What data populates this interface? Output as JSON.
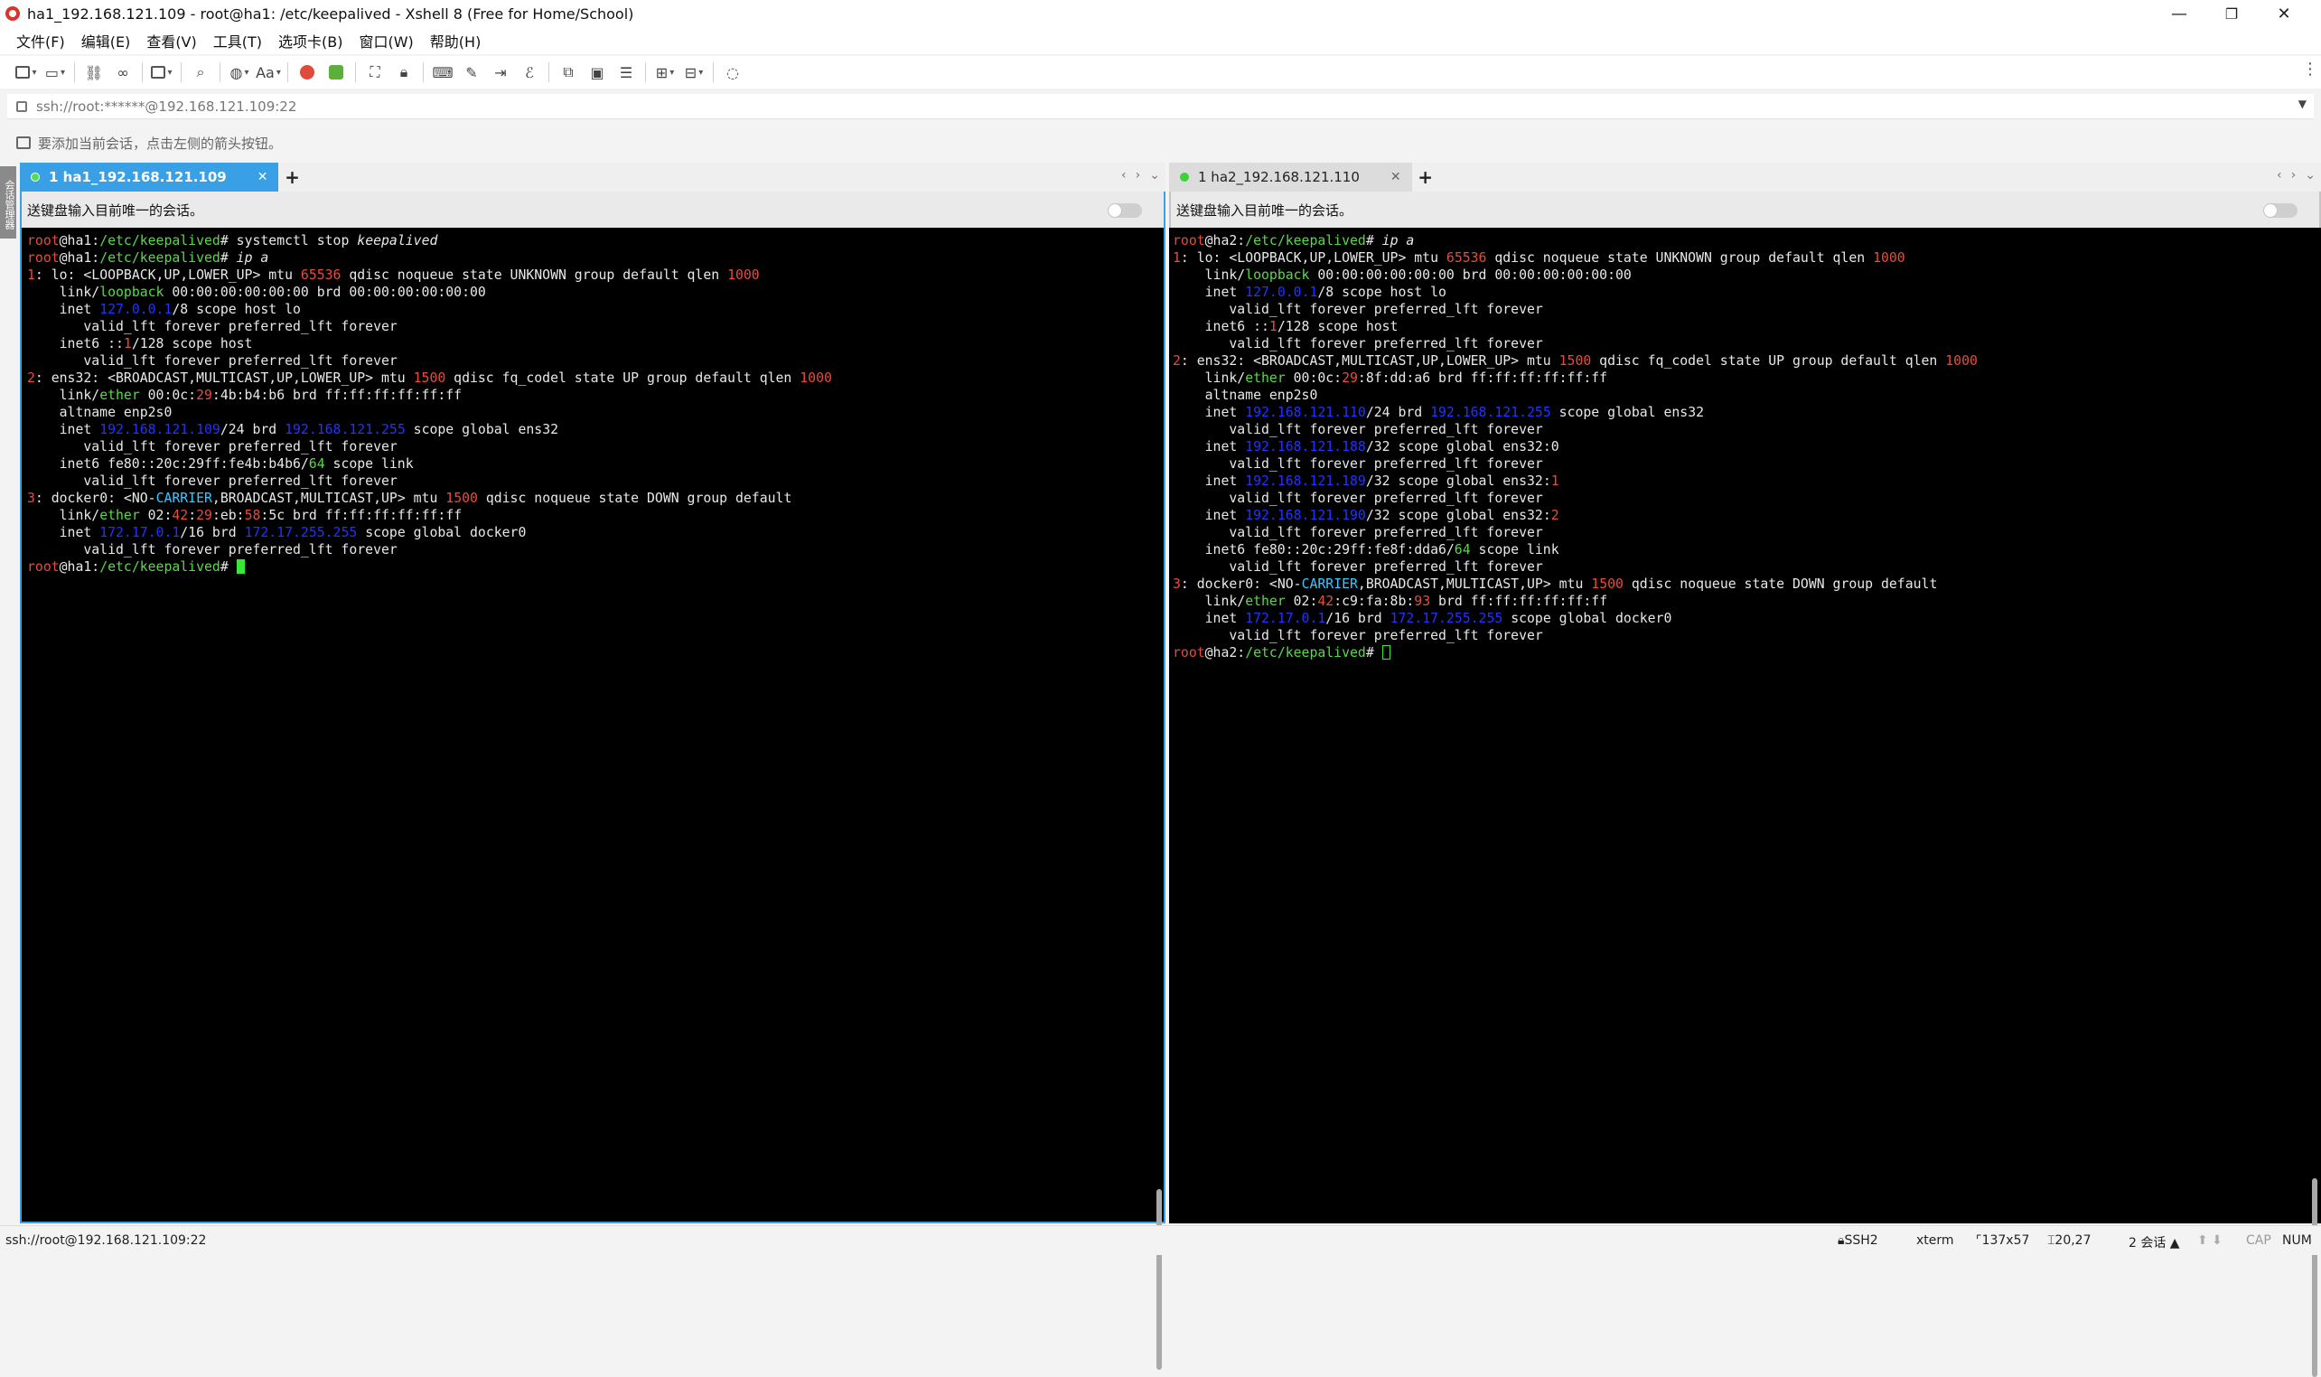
{
  "window": {
    "title": "ha1_192.168.121.109 - root@ha1: /etc/keepalived - Xshell 8 (Free for Home/School)",
    "minimize": "—",
    "maximize": "❐",
    "close": "✕"
  },
  "menu": [
    "文件(F)",
    "编辑(E)",
    "查看(V)",
    "工具(T)",
    "选项卡(B)",
    "窗口(W)",
    "帮助(H)"
  ],
  "address": {
    "text": "ssh://root:******@192.168.121.109:22"
  },
  "hint": {
    "text": "要添加当前会话，点击左侧的箭头按钮。"
  },
  "session_strip": "会话管理器",
  "left_pane": {
    "tab_label": "1 ha1_192.168.121.109",
    "tab_close": "✕",
    "tab_add": "+",
    "broadcast_text": "送键盘输入目前唯一的会话。"
  },
  "right_pane": {
    "tab_label": "1 ha2_192.168.121.110",
    "tab_close": "✕",
    "tab_add": "+",
    "broadcast_text": "送键盘输入目前唯一的会话。"
  },
  "statusbar": {
    "connection": "ssh://root@192.168.121.109:22",
    "protocol": "SSH2",
    "terminal_type": "xterm",
    "size": "137x57",
    "cursor_pos": "20,27",
    "sessions": "2 会话",
    "cap": "CAP",
    "num": "NUM"
  },
  "colors": {
    "active_tab": "#3aa0e6",
    "terminal_bg": "#000000",
    "prompt_red": "#e74c3c",
    "path_green": "#59d94a",
    "ip_blue": "#2233ff",
    "link_cyan": "#36c8ff"
  },
  "terminal_left": [
    [
      [
        "root",
        "t-red"
      ],
      [
        "@ha1:",
        ""
      ],
      [
        "/etc/keepalived",
        "t-green"
      ],
      [
        "# ",
        ""
      ],
      [
        "systemctl stop ",
        ""
      ],
      [
        "keepalived",
        "t-italic"
      ]
    ],
    [
      [
        "root",
        "t-red"
      ],
      [
        "@ha1:",
        ""
      ],
      [
        "/etc/keepalived",
        "t-green"
      ],
      [
        "# ",
        ""
      ],
      [
        "ip a",
        "t-italic"
      ]
    ],
    [
      [
        "1",
        "t-red"
      ],
      [
        ": lo: <LOOPBACK,UP,LOWER_UP> mtu ",
        ""
      ],
      [
        "65536",
        "t-red"
      ],
      [
        " qdisc noqueue state UNKNOWN group default qlen ",
        ""
      ],
      [
        "1000",
        "t-red"
      ]
    ],
    [
      [
        "    link/",
        ""
      ],
      [
        "loopback",
        "t-green"
      ],
      [
        " 00:00:00:00:00:00 brd 00:00:00:00:00:00",
        ""
      ]
    ],
    [
      [
        "    inet ",
        ""
      ],
      [
        "127.0.0.1",
        "t-blue"
      ],
      [
        "/8 scope host lo",
        ""
      ]
    ],
    [
      [
        "       valid_lft forever preferred_lft forever",
        ""
      ]
    ],
    [
      [
        "    inet6 ::",
        ""
      ],
      [
        "1",
        "t-red"
      ],
      [
        "/128 scope host",
        ""
      ]
    ],
    [
      [
        "       valid_lft forever preferred_lft forever",
        ""
      ]
    ],
    [
      [
        "2",
        "t-red"
      ],
      [
        ": ens32: <BROADCAST,MULTICAST,UP,LOWER_UP> mtu ",
        ""
      ],
      [
        "1500",
        "t-red"
      ],
      [
        " qdisc fq_codel state UP group default qlen ",
        ""
      ],
      [
        "1000",
        "t-red"
      ]
    ],
    [
      [
        "    link/",
        ""
      ],
      [
        "ether",
        "t-green"
      ],
      [
        " 00:0c:",
        ""
      ],
      [
        "29",
        "t-red"
      ],
      [
        ":4b:b4:b6 brd ff:ff:ff:ff:ff:ff",
        ""
      ]
    ],
    [
      [
        "    altname enp2s0",
        ""
      ]
    ],
    [
      [
        "    inet ",
        ""
      ],
      [
        "192.168.121.109",
        "t-blue"
      ],
      [
        "/24 brd ",
        ""
      ],
      [
        "192.168.121.255",
        "t-blue"
      ],
      [
        " scope global ens32",
        ""
      ]
    ],
    [
      [
        "       valid_lft forever preferred_lft forever",
        ""
      ]
    ],
    [
      [
        "    inet6 fe80::20c:29ff:fe4b:b4b6/",
        ""
      ],
      [
        "64",
        "t-green"
      ],
      [
        " scope link",
        ""
      ]
    ],
    [
      [
        "       valid_lft forever preferred_lft forever",
        ""
      ]
    ],
    [
      [
        "3",
        "t-red"
      ],
      [
        ": docker0: <NO-",
        ""
      ],
      [
        "CARRIER",
        "t-cyan"
      ],
      [
        ",BROADCAST,MULTICAST,UP> mtu ",
        ""
      ],
      [
        "1500",
        "t-red"
      ],
      [
        " qdisc noqueue state DOWN group default",
        ""
      ]
    ],
    [
      [
        "    link/",
        ""
      ],
      [
        "ether",
        "t-green"
      ],
      [
        " 02:",
        ""
      ],
      [
        "42",
        "t-red"
      ],
      [
        ":",
        ""
      ],
      [
        "29",
        "t-red"
      ],
      [
        ":eb:",
        ""
      ],
      [
        "58",
        "t-red"
      ],
      [
        ":5c brd ff:ff:ff:ff:ff:ff",
        ""
      ]
    ],
    [
      [
        "    inet ",
        ""
      ],
      [
        "172.17.0.1",
        "t-blue"
      ],
      [
        "/16 brd ",
        ""
      ],
      [
        "172.17.255.255",
        "t-blue"
      ],
      [
        " scope global docker0",
        ""
      ]
    ],
    [
      [
        "       valid_lft forever preferred_lft forever",
        ""
      ]
    ],
    [
      [
        "root",
        "t-red"
      ],
      [
        "@ha1:",
        ""
      ],
      [
        "/etc/keepalived",
        "t-green"
      ],
      [
        "# ",
        ""
      ],
      [
        "",
        "cursor-left"
      ]
    ]
  ],
  "terminal_right": [
    [
      [
        "root",
        "t-red"
      ],
      [
        "@ha2:",
        ""
      ],
      [
        "/etc/keepalived",
        "t-green"
      ],
      [
        "# ",
        ""
      ],
      [
        "ip a",
        "t-italic"
      ]
    ],
    [
      [
        "1",
        "t-red"
      ],
      [
        ": lo: <LOOPBACK,UP,LOWER_UP> mtu ",
        ""
      ],
      [
        "65536",
        "t-red"
      ],
      [
        " qdisc noqueue state UNKNOWN group default qlen ",
        ""
      ],
      [
        "1000",
        "t-red"
      ]
    ],
    [
      [
        "    link/",
        ""
      ],
      [
        "loopback",
        "t-green"
      ],
      [
        " 00:00:00:00:00:00 brd 00:00:00:00:00:00",
        ""
      ]
    ],
    [
      [
        "    inet ",
        ""
      ],
      [
        "127.0.0.1",
        "t-blue"
      ],
      [
        "/8 scope host lo",
        ""
      ]
    ],
    [
      [
        "       valid_lft forever preferred_lft forever",
        ""
      ]
    ],
    [
      [
        "    inet6 ::",
        ""
      ],
      [
        "1",
        "t-red"
      ],
      [
        "/128 scope host",
        ""
      ]
    ],
    [
      [
        "       valid_lft forever preferred_lft forever",
        ""
      ]
    ],
    [
      [
        "2",
        "t-red"
      ],
      [
        ": ens32: <BROADCAST,MULTICAST,UP,LOWER_UP> mtu ",
        ""
      ],
      [
        "1500",
        "t-red"
      ],
      [
        " qdisc fq_codel state UP group default qlen ",
        ""
      ],
      [
        "1000",
        "t-red"
      ]
    ],
    [
      [
        "    link/",
        ""
      ],
      [
        "ether",
        "t-green"
      ],
      [
        " 00:0c:",
        ""
      ],
      [
        "29",
        "t-red"
      ],
      [
        ":8f:dd:a6 brd ff:ff:ff:ff:ff:ff",
        ""
      ]
    ],
    [
      [
        "    altname enp2s0",
        ""
      ]
    ],
    [
      [
        "    inet ",
        ""
      ],
      [
        "192.168.121.110",
        "t-blue"
      ],
      [
        "/24 brd ",
        ""
      ],
      [
        "192.168.121.255",
        "t-blue"
      ],
      [
        " scope global ens32",
        ""
      ]
    ],
    [
      [
        "       valid_lft forever preferred_lft forever",
        ""
      ]
    ],
    [
      [
        "    inet ",
        ""
      ],
      [
        "192.168.121.188",
        "t-blue"
      ],
      [
        "/32 scope global ens32:0",
        ""
      ]
    ],
    [
      [
        "       valid_lft forever preferred_lft forever",
        ""
      ]
    ],
    [
      [
        "    inet ",
        ""
      ],
      [
        "192.168.121.189",
        "t-blue"
      ],
      [
        "/32 scope global ens32:",
        ""
      ],
      [
        "1",
        "t-red"
      ]
    ],
    [
      [
        "       valid_lft forever preferred_lft forever",
        ""
      ]
    ],
    [
      [
        "    inet ",
        ""
      ],
      [
        "192.168.121.190",
        "t-blue"
      ],
      [
        "/32 scope global ens32:",
        ""
      ],
      [
        "2",
        "t-red"
      ]
    ],
    [
      [
        "       valid_lft forever preferred_lft forever",
        ""
      ]
    ],
    [
      [
        "    inet6 fe80::20c:29ff:fe8f:dda6/",
        ""
      ],
      [
        "64",
        "t-green"
      ],
      [
        " scope link",
        ""
      ]
    ],
    [
      [
        "       valid_lft forever preferred_lft forever",
        ""
      ]
    ],
    [
      [
        "3",
        "t-red"
      ],
      [
        ": docker0: <NO-",
        ""
      ],
      [
        "CARRIER",
        "t-cyan"
      ],
      [
        ",BROADCAST,MULTICAST,UP> mtu ",
        ""
      ],
      [
        "1500",
        "t-red"
      ],
      [
        " qdisc noqueue state DOWN group default",
        ""
      ]
    ],
    [
      [
        "    link/",
        ""
      ],
      [
        "ether",
        "t-green"
      ],
      [
        " 02:",
        ""
      ],
      [
        "42",
        "t-red"
      ],
      [
        ":c9:fa:8b:",
        ""
      ],
      [
        "93",
        "t-red"
      ],
      [
        " brd ff:ff:ff:ff:ff:ff",
        ""
      ]
    ],
    [
      [
        "    inet ",
        ""
      ],
      [
        "172.17.0.1",
        "t-blue"
      ],
      [
        "/16 brd ",
        ""
      ],
      [
        "172.17.255.255",
        "t-blue"
      ],
      [
        " scope global docker0",
        ""
      ]
    ],
    [
      [
        "       valid_lft forever preferred_lft forever",
        ""
      ]
    ],
    [
      [
        "root",
        "t-red"
      ],
      [
        "@ha2:",
        ""
      ],
      [
        "/etc/keepalived",
        "t-green"
      ],
      [
        "# ",
        ""
      ],
      [
        "",
        "cursor-right"
      ]
    ]
  ]
}
